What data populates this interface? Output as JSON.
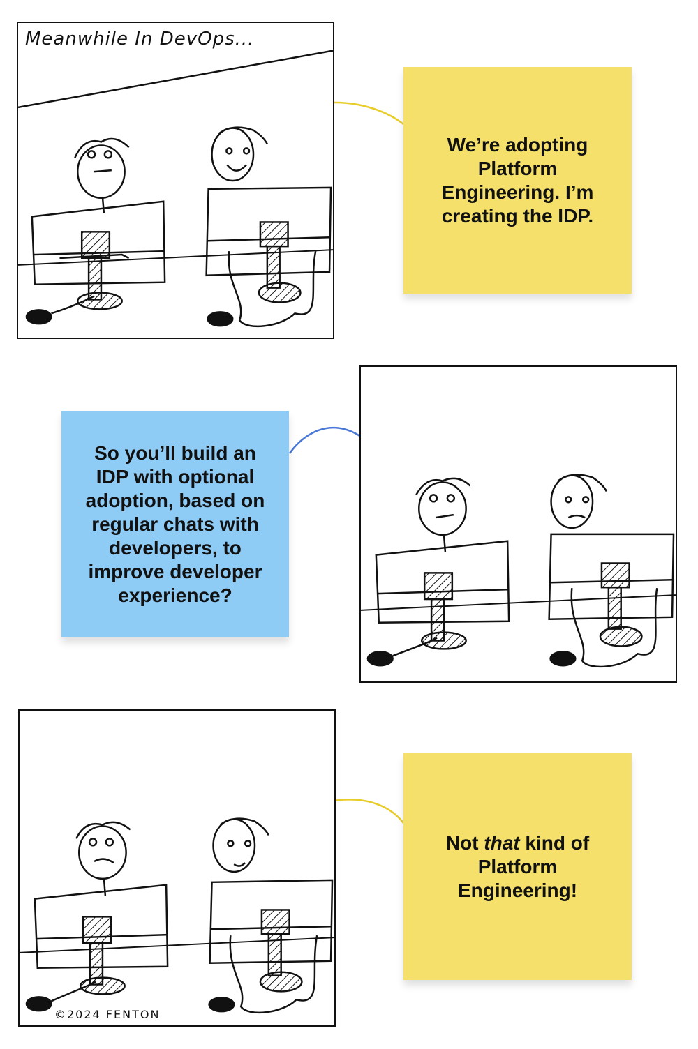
{
  "panel1": {
    "caption": "Meanwhile In DevOps...",
    "note": "We’re adopting Platform Engineering. I’m creating the IDP."
  },
  "panel2": {
    "note": "So you’ll build an IDP with optional adoption, based on regular chats with developers, to improve developer experience?"
  },
  "panel3": {
    "note_prefix": "Not ",
    "note_emphasis": "that",
    "note_suffix": " kind of Platform Engineering!",
    "copyright": "©2024 FENTON"
  },
  "colors": {
    "yellow_note": "#f5e06c",
    "blue_note": "#8ecbf5",
    "yellow_connector": "#e8cc2a",
    "blue_connector": "#4a78d6"
  }
}
